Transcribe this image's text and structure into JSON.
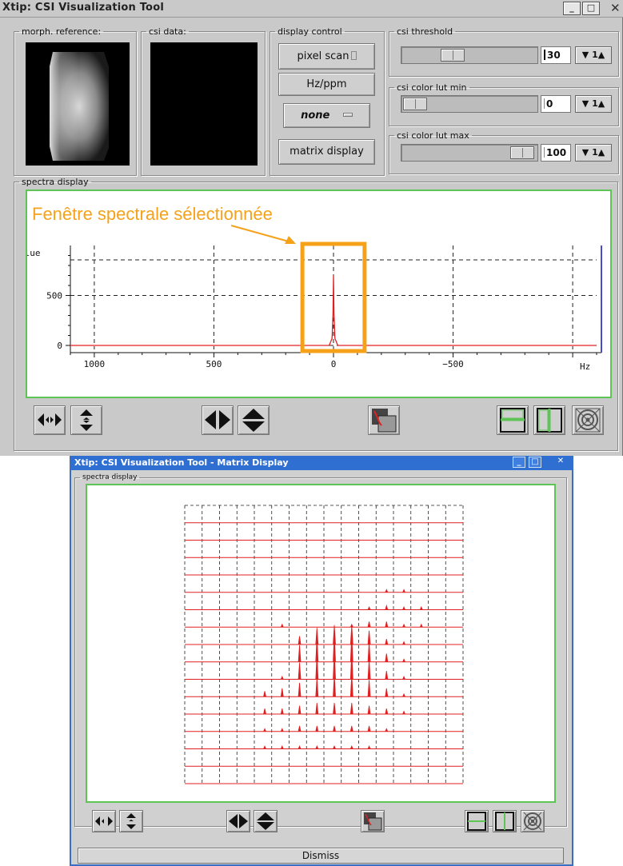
{
  "main_window": {
    "title": "Xtip: CSI Visualization Tool",
    "minimize_label": "_",
    "maximize_label": "□",
    "close_label": "✕"
  },
  "morph_reference": {
    "legend": "morph. reference:"
  },
  "csi_data": {
    "legend": "csi data:"
  },
  "display_control": {
    "legend": "display control",
    "pixel_scan_label": "pixel scan",
    "hz_ppm_label": "Hz/ppm",
    "none_label": "none",
    "matrix_display_label": "matrix display"
  },
  "csi_threshold": {
    "legend": "csi threshold",
    "value": "30",
    "step_label": "▼ 1▲",
    "level_percent": 35
  },
  "csi_color_lut_min": {
    "legend": "csi color lut min",
    "value": "0",
    "step_label": "▼ 1▲",
    "level_percent": 0
  },
  "csi_color_lut_max": {
    "legend": "csi color lut max",
    "value": "100",
    "step_label": "▼ 1▲",
    "level_percent": 100
  },
  "spectra_display": {
    "legend": "spectra display",
    "annotation": "Fenêtre spectrale sélectionnée",
    "ylabel": "alue",
    "xlabel": "Hz"
  },
  "matrix_window": {
    "title": "Xtip: CSI Visualization Tool - Matrix Display",
    "legend": "spectra display",
    "dismiss_label": "Dismiss",
    "minimize_label": "_",
    "maximize_label": "□",
    "close_label": "✕"
  },
  "chart_data": [
    {
      "type": "line",
      "x_direction": "reversed",
      "xlim": [
        1100,
        -1100
      ],
      "ylim": [
        -40,
        1000
      ],
      "x_ticks": [
        1000,
        500,
        0,
        -500
      ],
      "y_ticks": [
        0,
        500
      ],
      "grid": true,
      "xlabel": "Hz",
      "ylabel": "alue",
      "series": [
        {
          "x": [
            1100,
            18,
            6,
            2,
            0,
            -2,
            -6,
            -18,
            -1100
          ],
          "y": [
            0,
            0,
            70,
            320,
            700,
            320,
            70,
            0,
            0
          ]
        }
      ],
      "highlight_window": [
        130,
        -130
      ],
      "highlight_color": "#f5a21a",
      "series_color": "#e02020"
    },
    {
      "type": "line",
      "grid_columns": 16,
      "grid_rows": 16,
      "series_color": "#e02020",
      "peak_heights": [
        [
          0,
          0,
          0,
          0,
          0,
          0,
          0,
          0,
          0,
          0,
          0,
          0,
          0,
          0,
          0,
          0
        ],
        [
          0,
          0,
          0,
          0,
          0,
          0,
          0,
          0,
          0,
          0,
          0,
          0,
          0,
          0,
          0,
          0
        ],
        [
          0,
          0,
          0,
          0,
          0,
          0,
          0,
          0,
          0,
          0,
          0,
          0,
          0,
          0,
          0,
          0
        ],
        [
          0,
          0,
          0,
          0,
          0,
          0,
          0,
          0,
          0,
          0,
          0,
          0,
          0,
          0,
          0,
          0
        ],
        [
          0,
          0,
          0,
          0,
          0,
          0,
          0,
          0,
          0,
          0,
          0,
          0.1,
          0.1,
          0,
          0,
          0
        ],
        [
          0,
          0,
          0,
          0,
          0,
          0,
          0,
          0,
          0,
          0,
          0.1,
          0.15,
          0.1,
          0.1,
          0,
          0
        ],
        [
          0,
          0,
          0,
          0,
          0,
          0.1,
          0,
          0,
          0,
          0.1,
          0.2,
          0.2,
          0.1,
          0.1,
          0,
          0
        ],
        [
          0,
          0,
          0,
          0,
          0,
          0,
          0.3,
          0.6,
          0.7,
          0.7,
          0.5,
          0.2,
          0.1,
          0,
          0,
          0
        ],
        [
          0,
          0,
          0,
          0,
          0,
          0,
          0.6,
          0.9,
          1.0,
          1.0,
          0.7,
          0.3,
          0.1,
          0,
          0,
          0
        ],
        [
          0,
          0,
          0,
          0,
          0,
          0.1,
          0.6,
          0.9,
          1.0,
          1.0,
          0.7,
          0.3,
          0.1,
          0,
          0,
          0
        ],
        [
          0,
          0,
          0,
          0,
          0.2,
          0.3,
          0.5,
          0.7,
          0.8,
          0.8,
          0.6,
          0.3,
          0.1,
          0,
          0,
          0
        ],
        [
          0,
          0,
          0,
          0,
          0.2,
          0.2,
          0.3,
          0.4,
          0.4,
          0.4,
          0.3,
          0.2,
          0.1,
          0,
          0,
          0
        ],
        [
          0,
          0,
          0,
          0,
          0.1,
          0.1,
          0.2,
          0.2,
          0.2,
          0.2,
          0.2,
          0.1,
          0,
          0,
          0,
          0
        ],
        [
          0,
          0,
          0,
          0,
          0.1,
          0.1,
          0.1,
          0.1,
          0.1,
          0.1,
          0.1,
          0,
          0,
          0,
          0,
          0
        ],
        [
          0,
          0,
          0,
          0,
          0,
          0,
          0,
          0,
          0,
          0,
          0,
          0,
          0,
          0,
          0,
          0
        ],
        [
          0,
          0,
          0,
          0,
          0,
          0,
          0,
          0,
          0,
          0,
          0,
          0,
          0,
          0,
          0,
          0
        ]
      ]
    }
  ]
}
